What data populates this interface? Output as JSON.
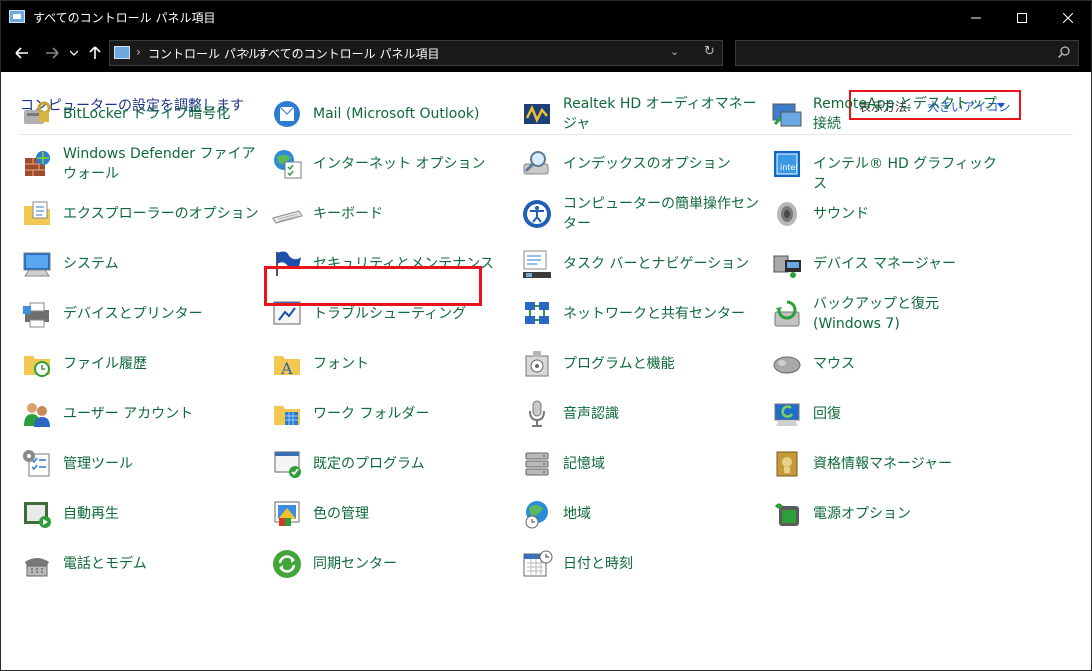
{
  "window": {
    "title": "すべてのコントロール パネル項目"
  },
  "address": {
    "crumbs": [
      "コントロール パネル",
      "すべてのコントロール パネル項目"
    ],
    "search_placeholder": ""
  },
  "header": {
    "heading": "コンピューターの設定を調整します",
    "view_by_label": "表示方法:",
    "view_by_value": "大きいアイコン"
  },
  "items": [
    {
      "label": "BitLocker ドライブ暗号化",
      "icon": "bitlocker-drive-icon"
    },
    {
      "label": "Mail (Microsoft Outlook)",
      "icon": "mail-icon"
    },
    {
      "label": "Realtek HD オーディオマネージャ",
      "icon": "realtek-audio-icon"
    },
    {
      "label": "RemoteApp とデスクトップ接続",
      "icon": "remoteapp-icon"
    },
    {
      "label": "Windows Defender ファイアウォール",
      "icon": "firewall-icon"
    },
    {
      "label": "インターネット オプション",
      "icon": "internet-options-icon"
    },
    {
      "label": "インデックスのオプション",
      "icon": "indexing-icon"
    },
    {
      "label": "インテル® HD グラフィックス",
      "icon": "intel-graphics-icon"
    },
    {
      "label": "エクスプローラーのオプション",
      "icon": "folder-options-icon"
    },
    {
      "label": "キーボード",
      "icon": "keyboard-icon"
    },
    {
      "label": "コンピューターの簡単操作センター",
      "icon": "ease-of-access-icon"
    },
    {
      "label": "サウンド",
      "icon": "speaker-icon"
    },
    {
      "label": "システム",
      "icon": "computer-icon"
    },
    {
      "label": "セキュリティとメンテナンス",
      "icon": "flag-icon"
    },
    {
      "label": "タスク バーとナビゲーション",
      "icon": "taskbar-icon"
    },
    {
      "label": "デバイス マネージャー",
      "icon": "device-manager-icon"
    },
    {
      "label": "デバイスとプリンター",
      "icon": "printer-icon"
    },
    {
      "label": "トラブルシューティング",
      "icon": "troubleshooting-icon"
    },
    {
      "label": "ネットワークと共有センター",
      "icon": "network-icon"
    },
    {
      "label": "バックアップと復元 (Windows 7)",
      "icon": "backup-icon"
    },
    {
      "label": "ファイル履歴",
      "icon": "file-history-icon"
    },
    {
      "label": "フォント",
      "icon": "fonts-icon"
    },
    {
      "label": "プログラムと機能",
      "icon": "programs-icon"
    },
    {
      "label": "マウス",
      "icon": "mouse-icon"
    },
    {
      "label": "ユーザー アカウント",
      "icon": "user-accounts-icon"
    },
    {
      "label": "ワーク フォルダー",
      "icon": "work-folders-icon"
    },
    {
      "label": "音声認識",
      "icon": "microphone-icon"
    },
    {
      "label": "回復",
      "icon": "recovery-icon"
    },
    {
      "label": "管理ツール",
      "icon": "admin-tools-icon"
    },
    {
      "label": "既定のプログラム",
      "icon": "default-programs-icon"
    },
    {
      "label": "記憶域",
      "icon": "storage-icon"
    },
    {
      "label": "資格情報マネージャー",
      "icon": "credential-manager-icon"
    },
    {
      "label": "自動再生",
      "icon": "autoplay-icon"
    },
    {
      "label": "色の管理",
      "icon": "color-management-icon"
    },
    {
      "label": "地域",
      "icon": "region-icon"
    },
    {
      "label": "電源オプション",
      "icon": "power-icon"
    },
    {
      "label": "電話とモデム",
      "icon": "phone-modem-icon"
    },
    {
      "label": "同期センター",
      "icon": "sync-icon"
    },
    {
      "label": "日付と時刻",
      "icon": "calendar-clock-icon"
    }
  ]
}
